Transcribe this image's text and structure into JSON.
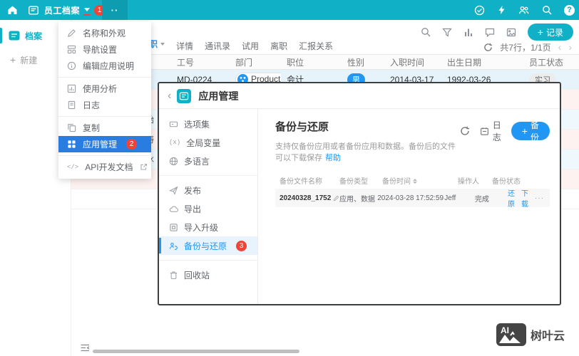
{
  "topbar": {
    "app_title": "员工档案",
    "notification_badge": "1",
    "more_dots": "··"
  },
  "sidebar": {
    "archive_label": "档案",
    "new_label": "新建"
  },
  "tabs": {
    "active_label": "在职",
    "items": [
      "详情",
      "通讯录",
      "试用",
      "离职",
      "汇报关系"
    ]
  },
  "list_toolbar": {
    "add_record_label": "记录",
    "pagination": "共7行，1/1页"
  },
  "employee_table": {
    "columns": [
      "工号",
      "部门",
      "职位",
      "性别",
      "入职时间",
      "出生日期",
      "员工状态"
    ],
    "row1": {
      "emp_id": "MD-0224",
      "dept": "Product",
      "position": "会计",
      "gender": "男",
      "hire_date": "2014-03-17",
      "birth_date": "1992-03-26",
      "status": "实习"
    },
    "partial_rows": [
      "始",
      "涛",
      "冰"
    ]
  },
  "app_menu": {
    "items": [
      {
        "label": "名称和外观"
      },
      {
        "label": "导航设置"
      },
      {
        "label": "编辑应用说明"
      },
      {
        "label": "使用分析"
      },
      {
        "label": "日志"
      },
      {
        "label": "复制"
      },
      {
        "label": "应用管理",
        "badge": "2"
      },
      {
        "label": "API开发文档"
      }
    ]
  },
  "modal": {
    "title": "应用管理",
    "nav": {
      "option_set": "选项集",
      "global_vars": "全局变量",
      "multi_lang": "多语言",
      "publish": "发布",
      "export": "导出",
      "import_upgrade": "导入升级",
      "backup_restore": "备份与还原",
      "badge": "3",
      "recycle_bin": "回收站"
    },
    "content": {
      "title": "备份与还原",
      "description": "支持仅备份应用或者备份应用和数据。备份后的文件可以下载保存",
      "help_link": "帮助",
      "log_button": "日志",
      "backup_button": "备份",
      "table": {
        "columns": [
          "备份文件名称",
          "备份类型",
          "备份时间",
          "操作人",
          "备份状态"
        ],
        "row": {
          "name": "20240328_1752",
          "type": "应用、数据",
          "time": "2024-03-28 17:52:59",
          "operator": "Jeff",
          "status": "完成",
          "action_restore": "还原",
          "action_download": "下载",
          "action_more": "···"
        }
      }
    }
  },
  "watermark": {
    "logo_text": "AI",
    "brand": "树叶云"
  },
  "colors": {
    "topbar_teal": "#10b1c6",
    "primary_blue": "#2196f3",
    "menu_highlight_blue": "#2a7de0",
    "badge_red": "#f44336",
    "selected_row_blue": "#e6f3fb"
  }
}
